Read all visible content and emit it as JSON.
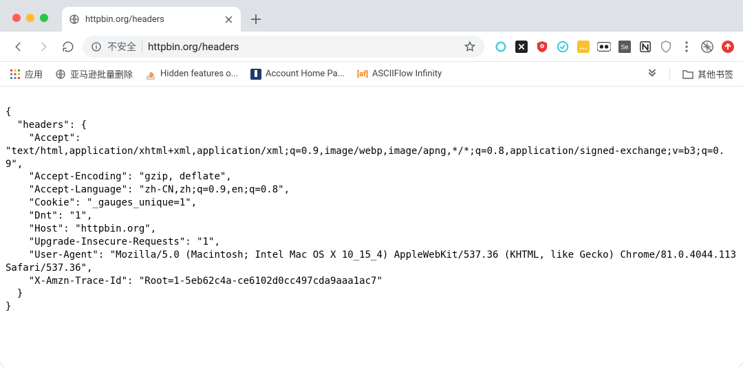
{
  "window": {
    "tab_title": "httpbin.org/headers"
  },
  "toolbar": {
    "insecure_label": "不安全",
    "url": "httpbin.org/headers"
  },
  "bookmarks": {
    "apps_label": "应用",
    "items": [
      {
        "label": "亚马逊批量删除"
      },
      {
        "label": "Hidden features o..."
      },
      {
        "label": "Account Home Pa..."
      },
      {
        "label": "ASCIIFlow Infinity"
      }
    ],
    "other_label": "其他书签"
  },
  "content_lines": [
    "{",
    "  \"headers\": {",
    "    \"Accept\":",
    "\"text/html,application/xhtml+xml,application/xml;q=0.9,image/webp,image/apng,*/*;q=0.8,application/signed-exchange;v=b3;q=0.9\",",
    "    \"Accept-Encoding\": \"gzip, deflate\",",
    "    \"Accept-Language\": \"zh-CN,zh;q=0.9,en;q=0.8\",",
    "    \"Cookie\": \"_gauges_unique=1\",",
    "    \"Dnt\": \"1\",",
    "    \"Host\": \"httpbin.org\",",
    "    \"Upgrade-Insecure-Requests\": \"1\",",
    "    \"User-Agent\": \"Mozilla/5.0 (Macintosh; Intel Mac OS X 10_15_4) AppleWebKit/537.36 (KHTML, like Gecko) Chrome/81.0.4044.113 Safari/537.36\",",
    "    \"X-Amzn-Trace-Id\": \"Root=1-5eb62c4a-ce6102d0cc497cda9aaa1ac7\"",
    "  }",
    "}"
  ],
  "ext_colors": {
    "circle_ring": "#4dd0e1",
    "x_box": "#222",
    "ublock": "#e53935",
    "teal_check": "#26c6da",
    "yellow_box": "#fbc02d",
    "panda_bg": "#fff",
    "se_box": "#444",
    "notion": "#222",
    "mcafee": "#8a8a8a",
    "compass": "#5f6368",
    "red_dot": "#e53935"
  }
}
